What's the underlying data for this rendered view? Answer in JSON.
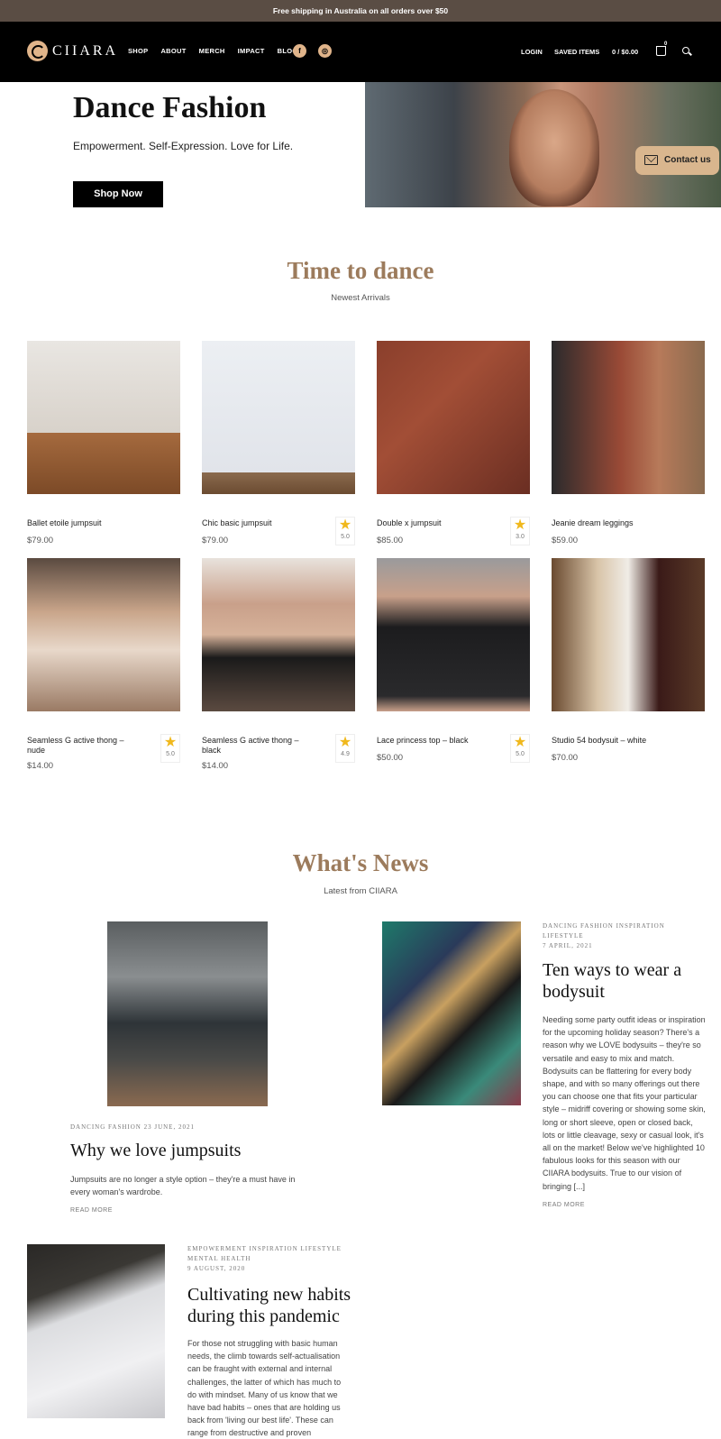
{
  "topbar": {
    "text": "Free shipping in Australia on all orders over $50"
  },
  "nav": {
    "logo": "CIIARA",
    "links": [
      "SHOP",
      "ABOUT",
      "MERCH",
      "IMPACT",
      "BLOG"
    ],
    "social": [
      "facebook-icon",
      "instagram-icon"
    ],
    "login": "LOGIN",
    "saved": "SAVED ITEMS",
    "cart": "0 / $0.00",
    "cart_count": "0"
  },
  "hero": {
    "title": "Dance Fashion",
    "subtitle": "Empowerment. Self-Expression. Love for Life.",
    "button": "Shop Now",
    "contact": "Contact us"
  },
  "arrivals": {
    "title": "Time to dance",
    "subtitle": "Newest Arrivals",
    "products": [
      {
        "name": "Ballet etoile jumpsuit",
        "price": "$79.00",
        "rating": ""
      },
      {
        "name": "Chic basic jumpsuit",
        "price": "$79.00",
        "rating": "5.0"
      },
      {
        "name": "Double x jumpsuit",
        "price": "$85.00",
        "rating": "3.0"
      },
      {
        "name": "Jeanie dream leggings",
        "price": "$59.00",
        "rating": ""
      },
      {
        "name": "Seamless G active thong – nude",
        "price": "$14.00",
        "rating": "5.0"
      },
      {
        "name": "Seamless G active thong – black",
        "price": "$14.00",
        "rating": "4.9"
      },
      {
        "name": "Lace princess top – black",
        "price": "$50.00",
        "rating": "5.0"
      },
      {
        "name": "Studio 54 bodysuit – white",
        "price": "$70.00",
        "rating": ""
      }
    ]
  },
  "news": {
    "title": "What's News",
    "subtitle": "Latest from CIIARA",
    "posts": [
      {
        "tags": "DANCING   FASHION   23 JUNE, 2021",
        "title": "Why we love jumpsuits",
        "text": "Jumpsuits are no longer a style option – they're a must have in every woman's wardrobe.",
        "read_more": "READ MORE"
      },
      {
        "tags": "DANCING   FASHION   INSPIRATION\nLIFESTYLE\n7 APRIL, 2021",
        "title": "Ten ways to wear a bodysuit",
        "text": "Needing some party outfit ideas or inspiration for the upcoming holiday season? There's a reason why we LOVE bodysuits – they're so versatile and easy to mix and match. Bodysuits can be flattering for every body shape, and with so many offerings out there you can choose one that fits your particular style – midriff covering or showing some skin, long or short sleeve, open or closed back, lots or little cleavage, sexy or casual look, it's all on the market! Below we've highlighted 10 fabulous looks for this season with our CIIARA bodysuits. True to our vision of bringing [...]",
        "read_more": "READ MORE"
      },
      {
        "tags": "EMPOWERMENT   INSPIRATION   LIFESTYLE\nMENTAL HEALTH\n9 AUGUST, 2020",
        "title": "Cultivating new habits during this pandemic",
        "text": "For those not struggling with basic human needs, the climb towards self-actualisation can be fraught with external and internal challenges, the latter of which has much to do with mindset. Many of us know that we have bad habits – ones that are holding us back from 'living our best life'. These can range from destructive and proven",
        "read_more": ""
      }
    ]
  },
  "colors": {
    "accent": "#9c7b5c",
    "topbar": "#5a4d44",
    "nav": "#000000",
    "contact": "#d9b68e",
    "star": "#f0b81c"
  }
}
